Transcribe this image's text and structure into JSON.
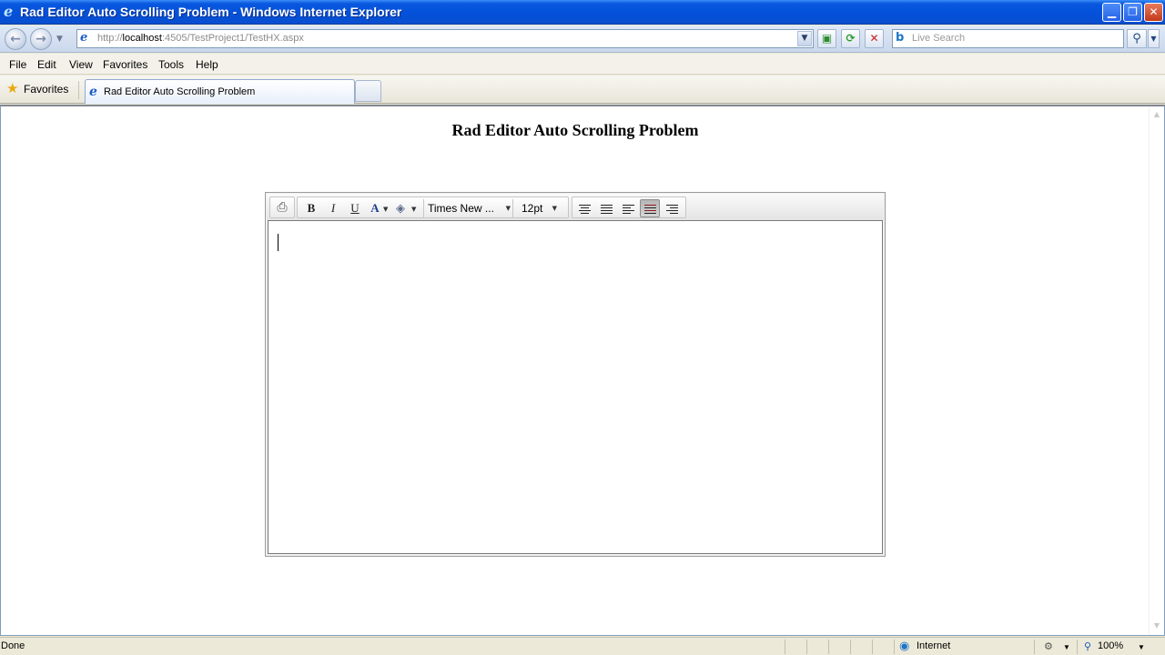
{
  "window": {
    "title": "Rad Editor Auto Scrolling Problem - Windows Internet Explorer",
    "minimize_glyph": "▁",
    "restore_glyph": "❐",
    "close_glyph": "✕"
  },
  "address": {
    "url_prefix": "http://",
    "url_host": "localhost",
    "url_rest": ":4505/TestProject1/TestHX.aspx",
    "search_placeholder": "Live Search"
  },
  "menu": {
    "items": [
      "File",
      "Edit",
      "View",
      "Favorites",
      "Tools",
      "Help"
    ]
  },
  "favorites": {
    "label": "Favorites"
  },
  "tabs": {
    "active_label": "Rad Editor Auto Scrolling Problem"
  },
  "page": {
    "title": "Rad Editor Auto Scrolling Problem"
  },
  "editor": {
    "font_name": "Times New ...",
    "font_size": "12pt",
    "bold_glyph": "B",
    "italic_glyph": "I",
    "underline_glyph": "U",
    "forecolor_glyph": "A",
    "active_align": "justify-right-variant"
  },
  "status": {
    "text": "Done",
    "zone": "Internet",
    "zoom": "100%"
  },
  "colors": {
    "titlebar": "#0450d8",
    "chrome": "#ece9d8",
    "accent": "#1c5bc8"
  }
}
